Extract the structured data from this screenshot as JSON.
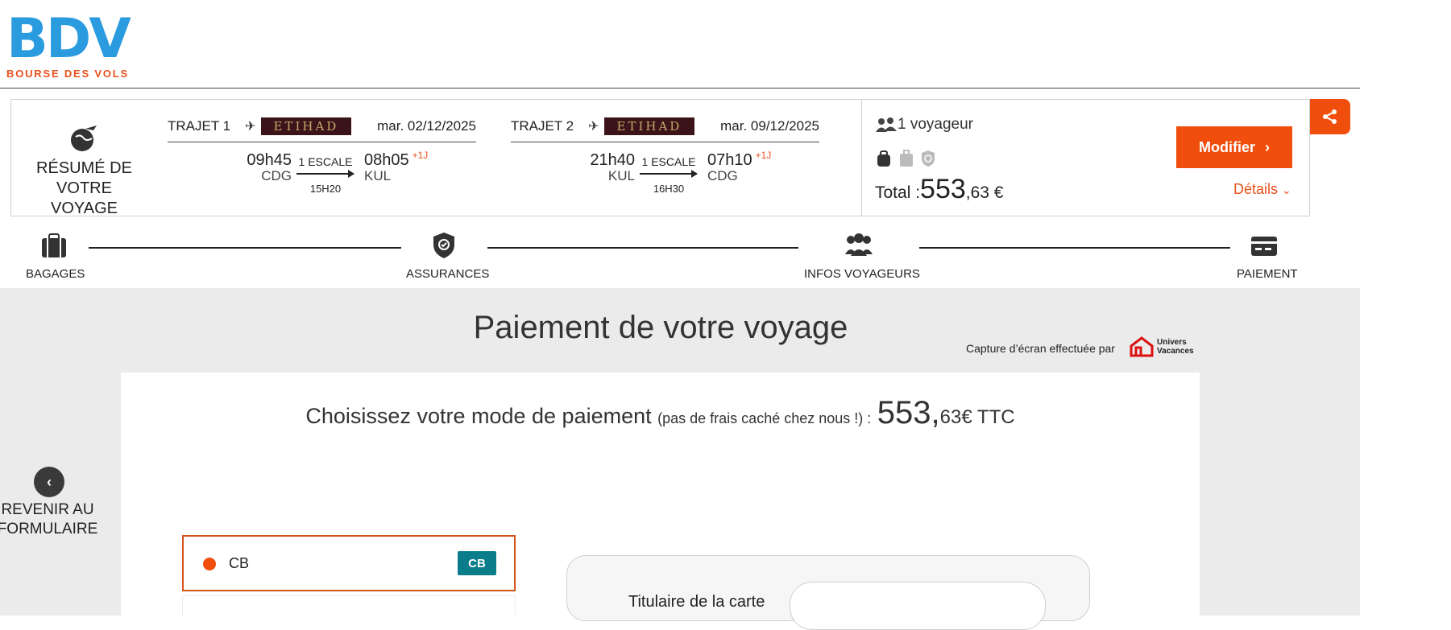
{
  "logo": {
    "main": "BDV",
    "sub": "BOURSE DES VOLS"
  },
  "summary": {
    "title_line1": "RÉSUMÉ DE",
    "title_line2": "VOTRE VOYAGE",
    "trajets": [
      {
        "label": "TRAJET 1",
        "airline": "ETIHAD",
        "date": "mar. 02/12/2025",
        "dep_time": "09h45",
        "dep_ap": "CDG",
        "stops": "1 ESCALE",
        "duration": "15H20",
        "arr_time": "08h05",
        "arr_ap": "KUL",
        "plus": "+1J"
      },
      {
        "label": "TRAJET 2",
        "airline": "ETIHAD",
        "date": "mar. 09/12/2025",
        "dep_time": "21h40",
        "dep_ap": "KUL",
        "stops": "1 ESCALE",
        "duration": "16H30",
        "arr_time": "07h10",
        "arr_ap": "CDG",
        "plus": "+1J"
      }
    ],
    "travellers": "1 voyageur",
    "total_label": "Total :",
    "total_int": "553",
    "total_dec": ",63 €",
    "modify_label": "Modifier",
    "details_label": "Détails"
  },
  "steps": [
    "BAGAGES",
    "ASSURANCES",
    "INFOS VOYAGEURS",
    "PAIEMENT"
  ],
  "payment": {
    "title": "Paiement de votre voyage",
    "capture_note": "Capture d’écran effectuée par",
    "uv_line1": "Univers",
    "uv_line2": "Vacances",
    "choose_main": "Choisissez votre mode de paiement",
    "choose_small": "(pas de frais caché chez nous !) :",
    "price_int": "553,",
    "price_dec": "63€ TTC",
    "back_line1": "REVENIR AU",
    "back_line2": "FORMULAIRE",
    "option_cb": "CB",
    "cb_logo": "CB",
    "holder_label": "Titulaire de la carte",
    "holder_value": ""
  },
  "colors": {
    "brand_blue": "#2b9be0",
    "brand_orange": "#f04e0c",
    "etihad_bg": "#3a1418"
  }
}
